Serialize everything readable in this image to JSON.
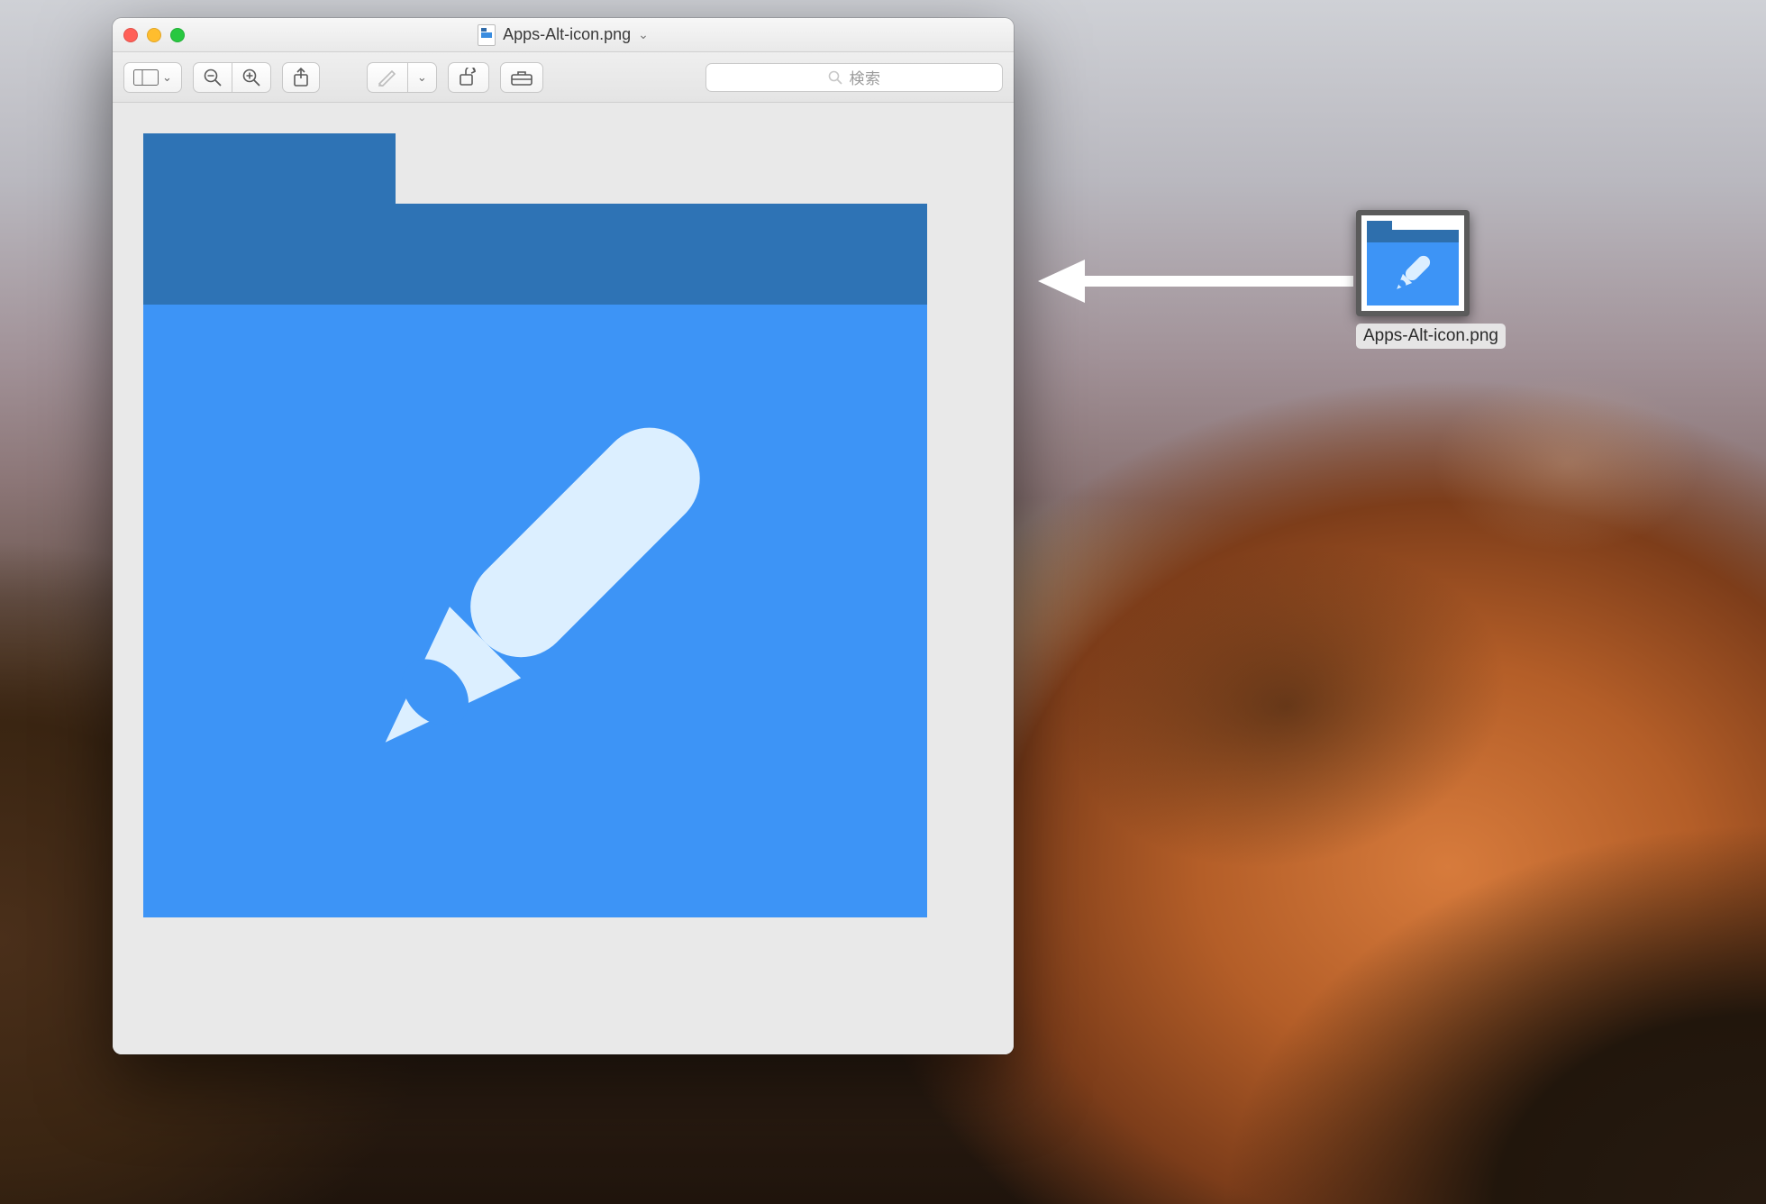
{
  "window": {
    "title": "Apps-Alt-icon.png",
    "search_placeholder": "検索"
  },
  "desktop_icon": {
    "label": "Apps-Alt-icon.png"
  },
  "colors": {
    "folder_dark": "#2e73b5",
    "folder_light": "#3d94f6",
    "pencil": "#dcefff"
  }
}
